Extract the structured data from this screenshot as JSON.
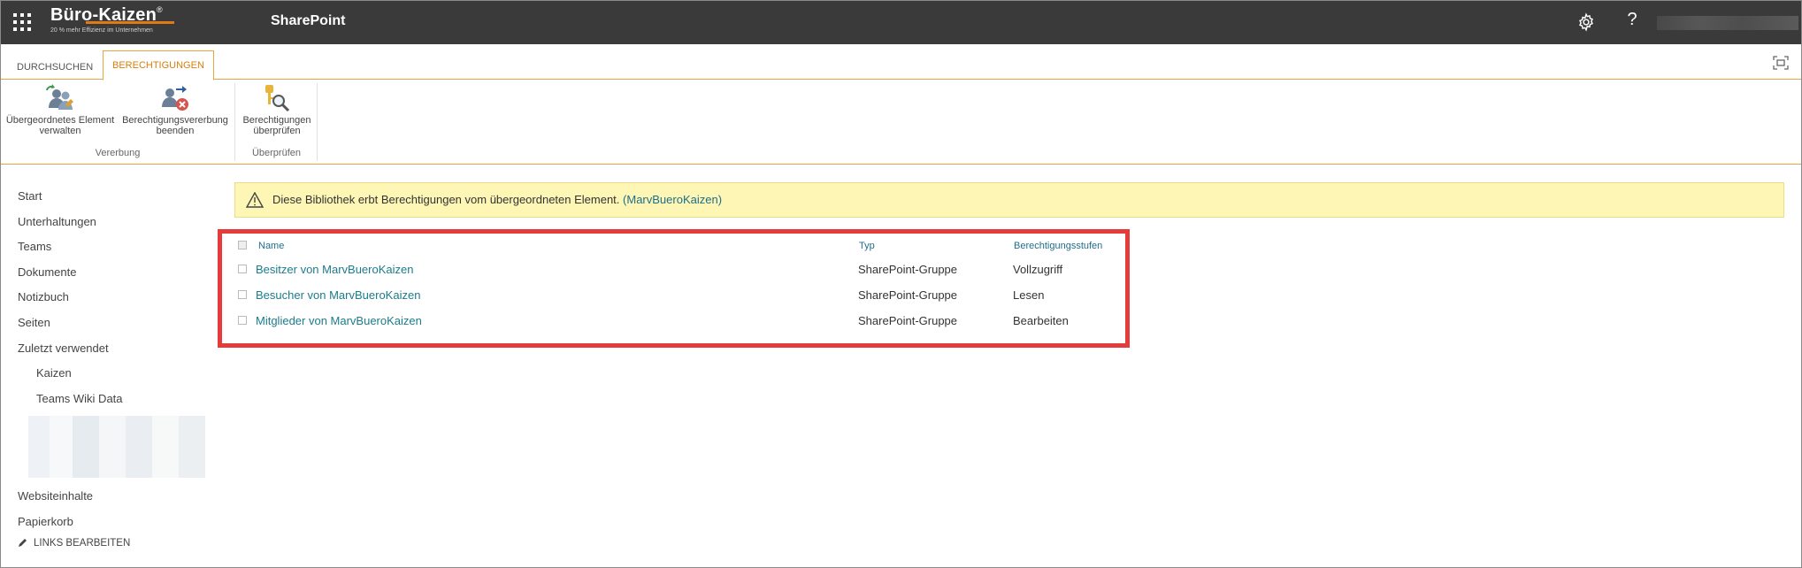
{
  "suite": {
    "logo_name": "Büro-Kaizen",
    "logo_reg": "®",
    "logo_tagline": "20 % mehr Effizienz im Unternehmen",
    "app_title": "SharePoint",
    "help_label": "?"
  },
  "ribbon": {
    "tabs": [
      {
        "label": "DURCHSUCHEN"
      },
      {
        "label": "BERECHTIGUNGEN"
      }
    ],
    "groups": [
      {
        "label": "Vererbung",
        "commands": [
          {
            "label": "Übergeordnetes Element verwalten",
            "icon": "manage-parent-icon"
          },
          {
            "label": "Berechtigungsvererbung beenden",
            "icon": "stop-inheritance-icon"
          }
        ]
      },
      {
        "label": "Überprüfen",
        "commands": [
          {
            "label": "Berechtigungen überprüfen",
            "icon": "check-permissions-icon"
          }
        ]
      }
    ]
  },
  "nav": {
    "items": [
      {
        "label": "Start"
      },
      {
        "label": "Unterhaltungen"
      },
      {
        "label": "Teams"
      },
      {
        "label": "Dokumente"
      },
      {
        "label": "Notizbuch"
      },
      {
        "label": "Seiten"
      },
      {
        "label": "Zuletzt verwendet"
      }
    ],
    "recent": [
      {
        "label": "Kaizen"
      },
      {
        "label": "Teams Wiki Data"
      }
    ],
    "bottom_items": [
      {
        "label": "Websiteinhalte"
      },
      {
        "label": "Papierkorb"
      }
    ],
    "edit_links": "LINKS BEARBEITEN"
  },
  "infobar": {
    "message": "Diese Bibliothek erbt Berechtigungen vom übergeordneten Element.",
    "link": "(MarvBueroKaizen)"
  },
  "permissions_table": {
    "columns": {
      "name": "Name",
      "type": "Typ",
      "level": "Berechtigungsstufen"
    },
    "rows": [
      {
        "name": "Besitzer von MarvBueroKaizen",
        "type": "SharePoint-Gruppe",
        "level": "Vollzugriff"
      },
      {
        "name": "Besucher von MarvBueroKaizen",
        "type": "SharePoint-Gruppe",
        "level": "Lesen"
      },
      {
        "name": "Mitglieder von MarvBueroKaizen",
        "type": "SharePoint-Gruppe",
        "level": "Bearbeiten"
      }
    ]
  },
  "colors": {
    "suitebar": "#3a3a3a",
    "accent": "#e8a33a",
    "link": "#1b7c8a",
    "highlight_box": "#e53b3b",
    "infobar_bg": "#fdf6b5"
  }
}
